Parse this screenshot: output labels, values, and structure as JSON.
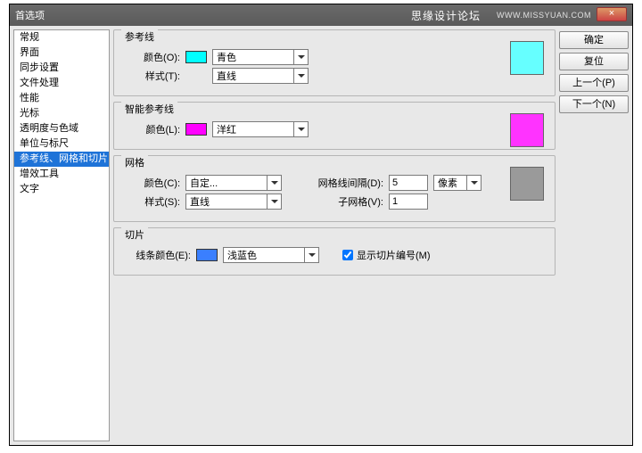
{
  "window": {
    "title": "首选项",
    "brand": "思缘设计论坛",
    "url": "WWW.MISSYUAN.COM",
    "close": "×"
  },
  "sidebar": {
    "items": [
      "常规",
      "界面",
      "同步设置",
      "文件处理",
      "性能",
      "光标",
      "透明度与色域",
      "单位与标尺",
      "参考线、网格和切片",
      "增效工具",
      "文字"
    ],
    "selected": 8
  },
  "buttons": {
    "ok": "确定",
    "reset": "复位",
    "prev": "上一个(P)",
    "next": "下一个(N)"
  },
  "guides": {
    "legend": "参考线",
    "color_label": "颜色(O):",
    "color_swatch": "#00ffff",
    "color_value": "青色",
    "style_label": "样式(T):",
    "style_value": "直线",
    "preview": "#66ffff"
  },
  "smart": {
    "legend": "智能参考线",
    "color_label": "颜色(L):",
    "color_swatch": "#ff00ff",
    "color_value": "洋红",
    "preview": "#ff33ff"
  },
  "grid": {
    "legend": "网格",
    "color_label": "颜色(C):",
    "color_value": "自定...",
    "style_label": "样式(S):",
    "style_value": "直线",
    "spacing_label": "网格线间隔(D):",
    "spacing_value": "5",
    "spacing_unit": "像素",
    "sub_label": "子网格(V):",
    "sub_value": "1",
    "preview": "#9a9a9a"
  },
  "slices": {
    "legend": "切片",
    "color_label": "线条颜色(E):",
    "color_swatch": "#3a7fff",
    "color_value": "浅蓝色",
    "show_label": "显示切片编号(M)",
    "show_checked": true
  }
}
